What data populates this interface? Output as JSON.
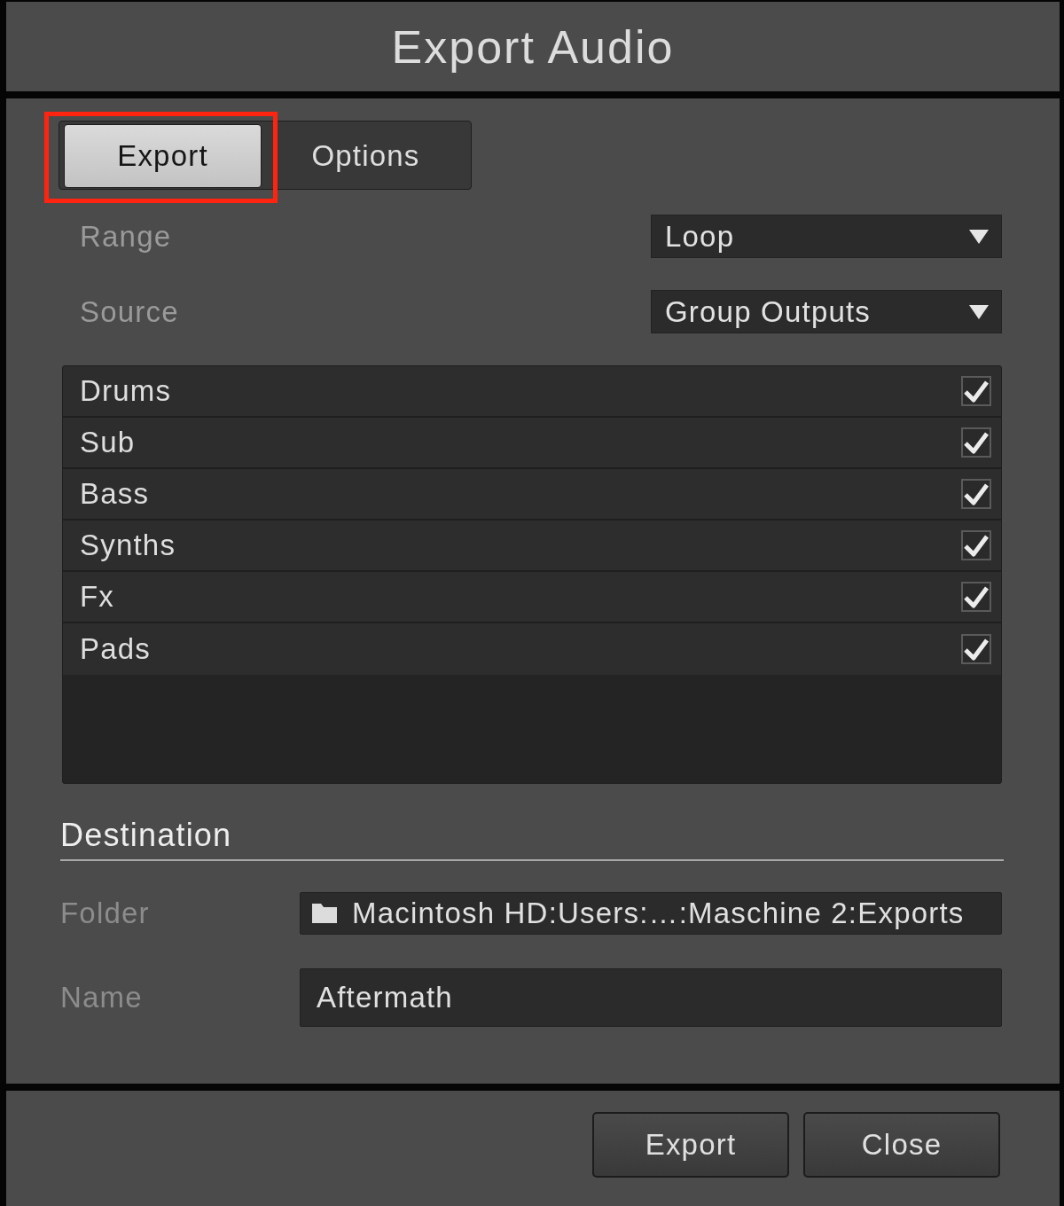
{
  "window": {
    "title": "Export Audio"
  },
  "tabs": [
    {
      "label": "Export",
      "selected": true,
      "highlighted": true
    },
    {
      "label": "Options",
      "selected": false,
      "highlighted": false
    }
  ],
  "settings": [
    {
      "label": "Range",
      "value": "Loop"
    },
    {
      "label": "Source",
      "value": "Group Outputs"
    }
  ],
  "sources": [
    {
      "name": "Drums",
      "checked": true
    },
    {
      "name": "Sub",
      "checked": true
    },
    {
      "name": "Bass",
      "checked": true
    },
    {
      "name": "Synths",
      "checked": true
    },
    {
      "name": "Fx",
      "checked": true
    },
    {
      "name": "Pads",
      "checked": true
    }
  ],
  "destination": {
    "heading": "Destination",
    "fields": [
      {
        "label": "Folder",
        "kind": "folder",
        "value": "Macintosh HD:Users:…:Maschine 2:Exports"
      },
      {
        "label": "Name",
        "kind": "text",
        "value": "Aftermath"
      }
    ]
  },
  "buttons": [
    "Export",
    "Close"
  ]
}
